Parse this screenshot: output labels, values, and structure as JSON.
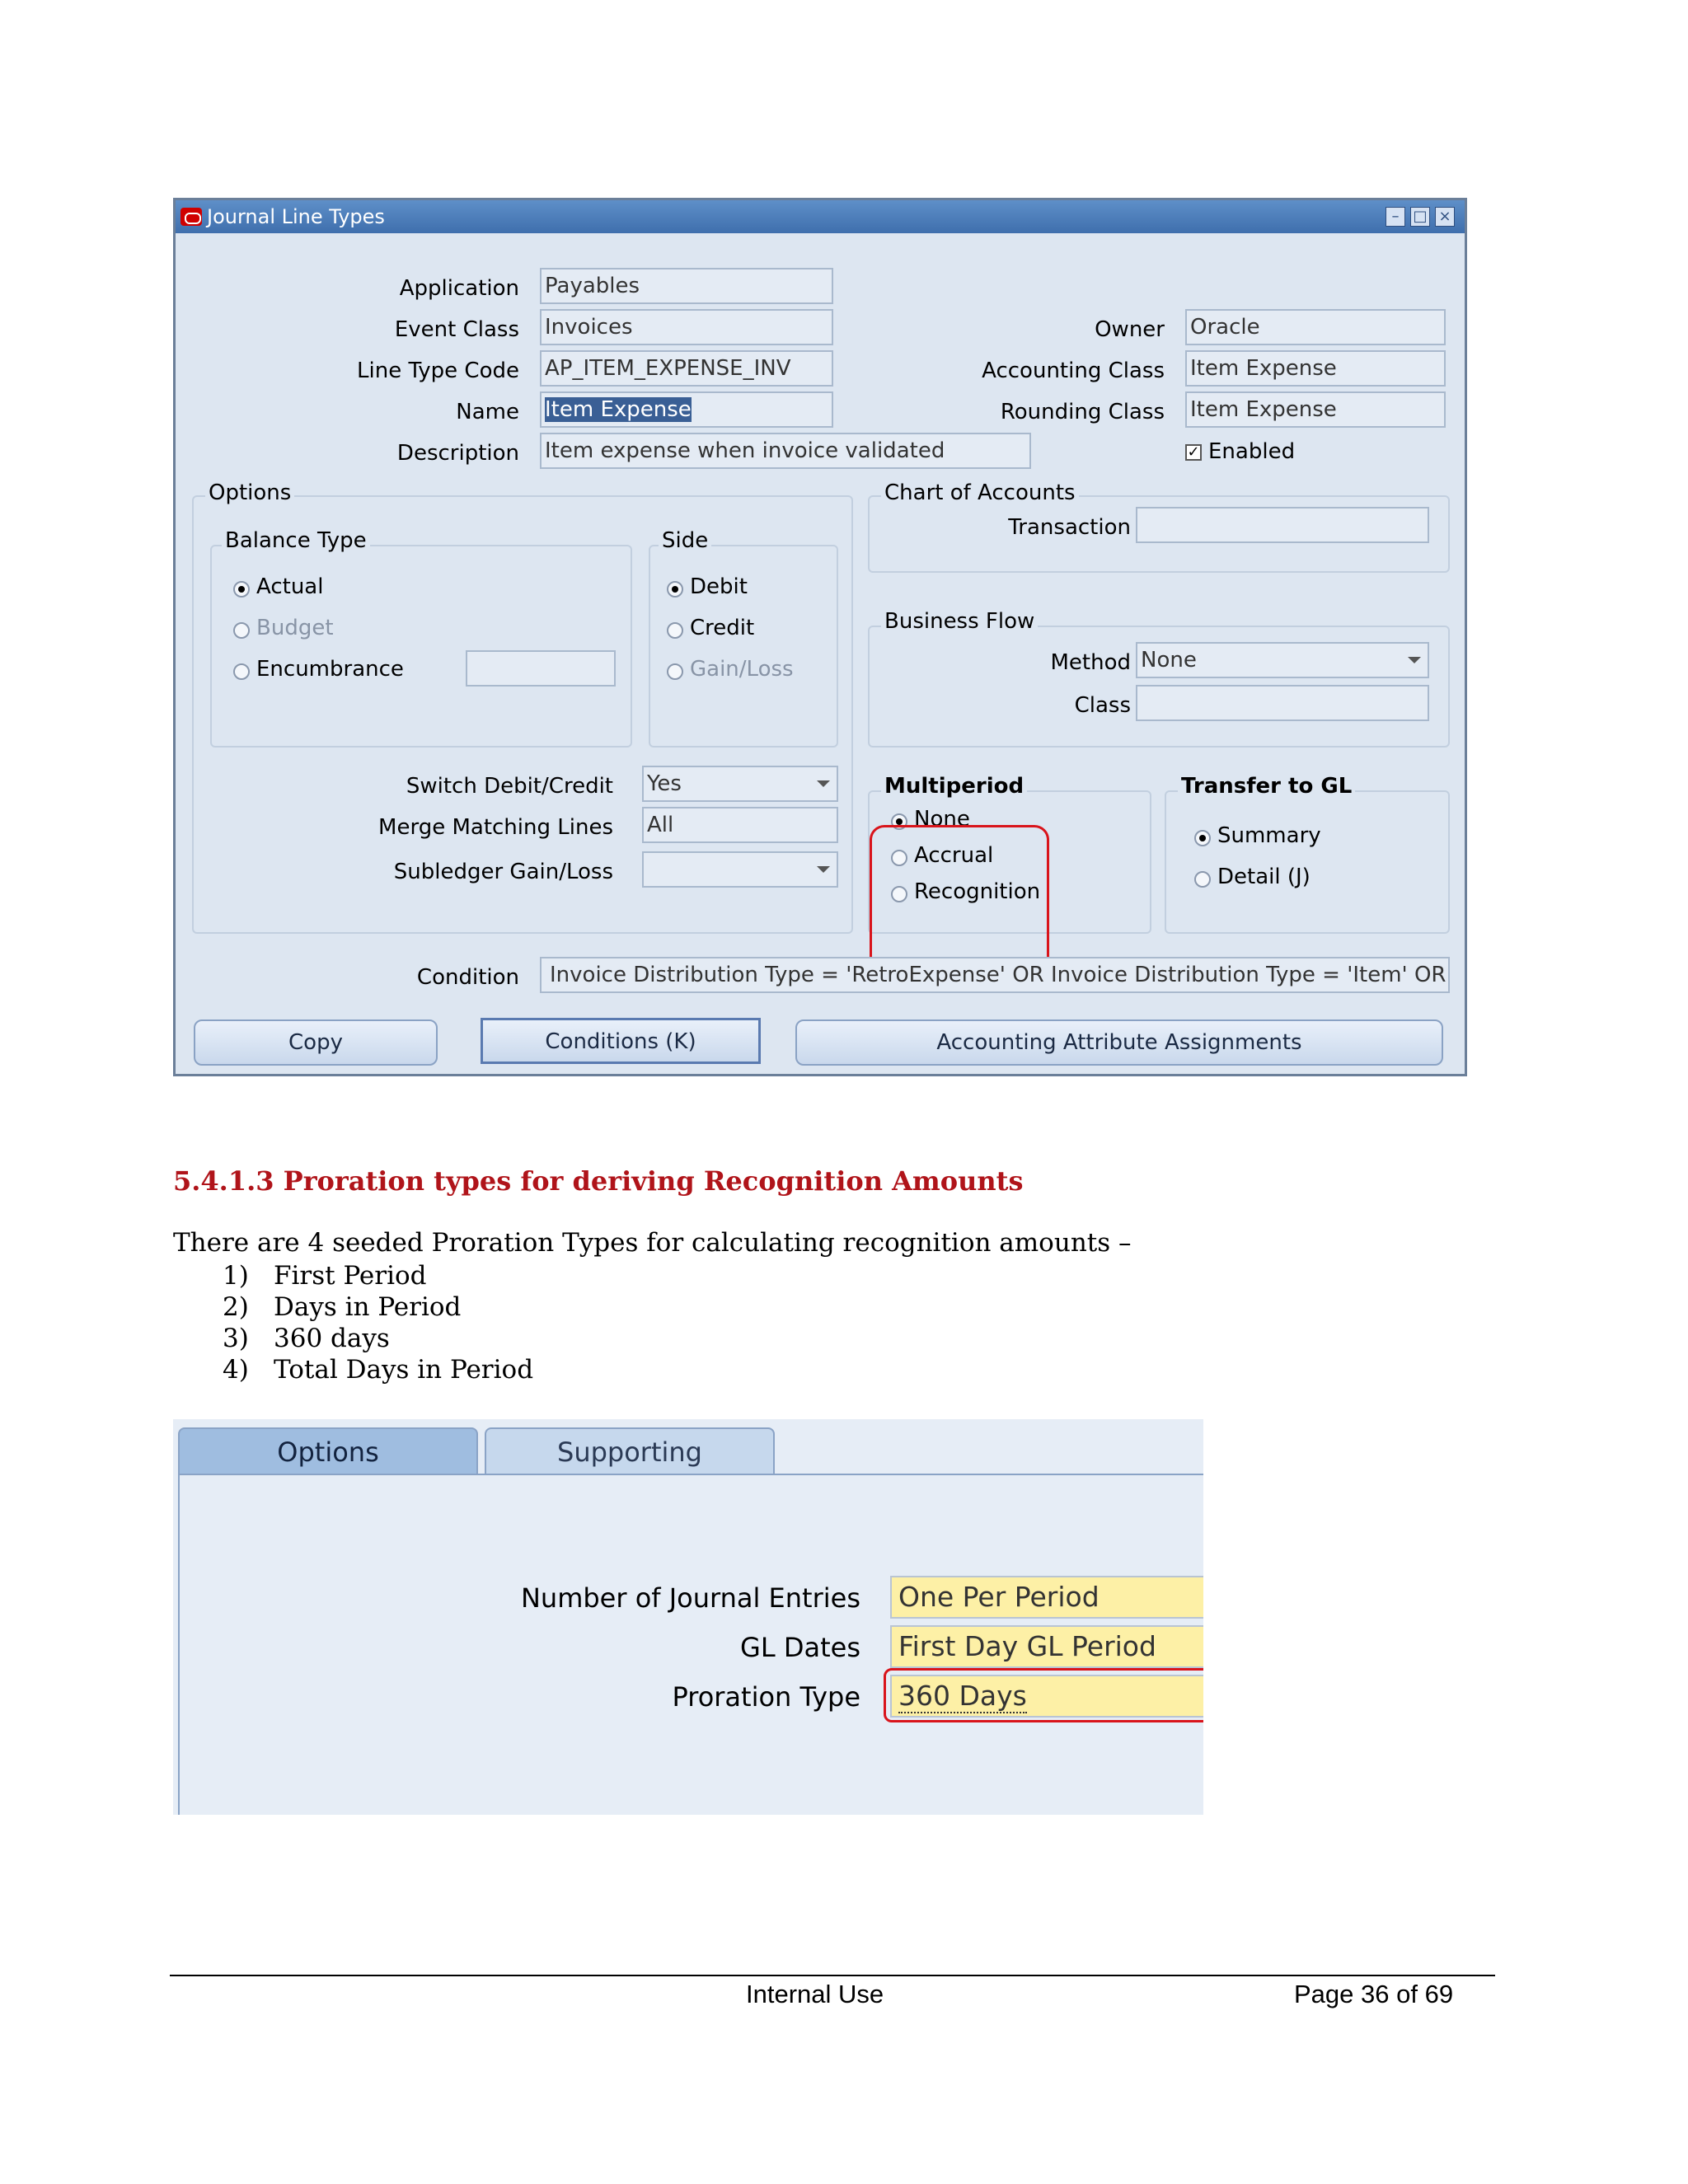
{
  "window": {
    "title": "Journal Line Types",
    "controls": [
      "minimize-icon",
      "maximize-icon",
      "close-icon"
    ]
  },
  "header_fields": {
    "application": {
      "label": "Application",
      "value": "Payables"
    },
    "event_class": {
      "label": "Event Class",
      "value": "Invoices"
    },
    "line_type_code": {
      "label": "Line Type Code",
      "value": "AP_ITEM_EXPENSE_INV"
    },
    "name": {
      "label": "Name",
      "value": "Item Expense"
    },
    "description": {
      "label": "Description",
      "value": "Item expense when invoice validated"
    },
    "owner": {
      "label": "Owner",
      "value": "Oracle"
    },
    "accounting_class": {
      "label": "Accounting Class",
      "value": "Item Expense"
    },
    "rounding_class": {
      "label": "Rounding Class",
      "value": "Item Expense"
    },
    "enabled": {
      "label": "Enabled",
      "checked": true
    }
  },
  "options": {
    "title": "Options",
    "balance_type": {
      "title": "Balance Type",
      "actual": "Actual",
      "budget": "Budget",
      "encumbrance": "Encumbrance",
      "selected": "Actual"
    },
    "side": {
      "title": "Side",
      "debit": "Debit",
      "credit": "Credit",
      "gain_loss": "Gain/Loss",
      "selected": "Debit"
    },
    "switch_debit_credit": {
      "label": "Switch Debit/Credit",
      "value": "Yes"
    },
    "merge_matching_lines": {
      "label": "Merge Matching Lines",
      "value": "All"
    },
    "subledger_gain_loss": {
      "label": "Subledger Gain/Loss",
      "value": ""
    }
  },
  "chart_of_accounts": {
    "title": "Chart of Accounts",
    "transaction": {
      "label": "Transaction",
      "value": ""
    }
  },
  "business_flow": {
    "title": "Business Flow",
    "method": {
      "label": "Method",
      "value": "None"
    },
    "class": {
      "label": "Class",
      "value": ""
    }
  },
  "multiperiod": {
    "title": "Multiperiod",
    "none": "None",
    "accrual": "Accrual",
    "recognition": "Recognition",
    "selected": "None"
  },
  "transfer_to_gl": {
    "title": "Transfer to GL",
    "summary": "Summary",
    "detail": "Detail (J)",
    "selected": "Summary"
  },
  "condition": {
    "label": "Condition",
    "value": "Invoice Distribution Type = 'RetroExpense' OR Invoice Distribution Type = 'Item' OR ( Invoic"
  },
  "buttons": {
    "copy": "Copy",
    "conditions": "Conditions (K)",
    "accounting_attribute_assignments": "Accounting Attribute Assignments"
  },
  "section": {
    "heading": "5.4.1.3 Proration types for deriving Recognition Amounts",
    "intro": "There are 4 seeded Proration Types for calculating recognition amounts –",
    "items": [
      {
        "num": "1)",
        "text": "First Period"
      },
      {
        "num": "2)",
        "text": "Days in Period"
      },
      {
        "num": "3)",
        "text": "360 days"
      },
      {
        "num": "4)",
        "text": "Total Days in Period"
      }
    ]
  },
  "options_panel": {
    "tabs": {
      "options": "Options",
      "supporting_references": "Supporting References"
    },
    "number_of_journal_entries": {
      "label": "Number of Journal Entries",
      "value": "One Per Period"
    },
    "gl_dates": {
      "label": "GL Dates",
      "value": "First Day GL Period"
    },
    "proration_type": {
      "label": "Proration Type",
      "value": "360 Days"
    },
    "field_color": "#fdf0a6",
    "highlight_color": "#d9141b"
  },
  "footer": {
    "center": "Internal Use",
    "page": "Page 36 of 69"
  }
}
